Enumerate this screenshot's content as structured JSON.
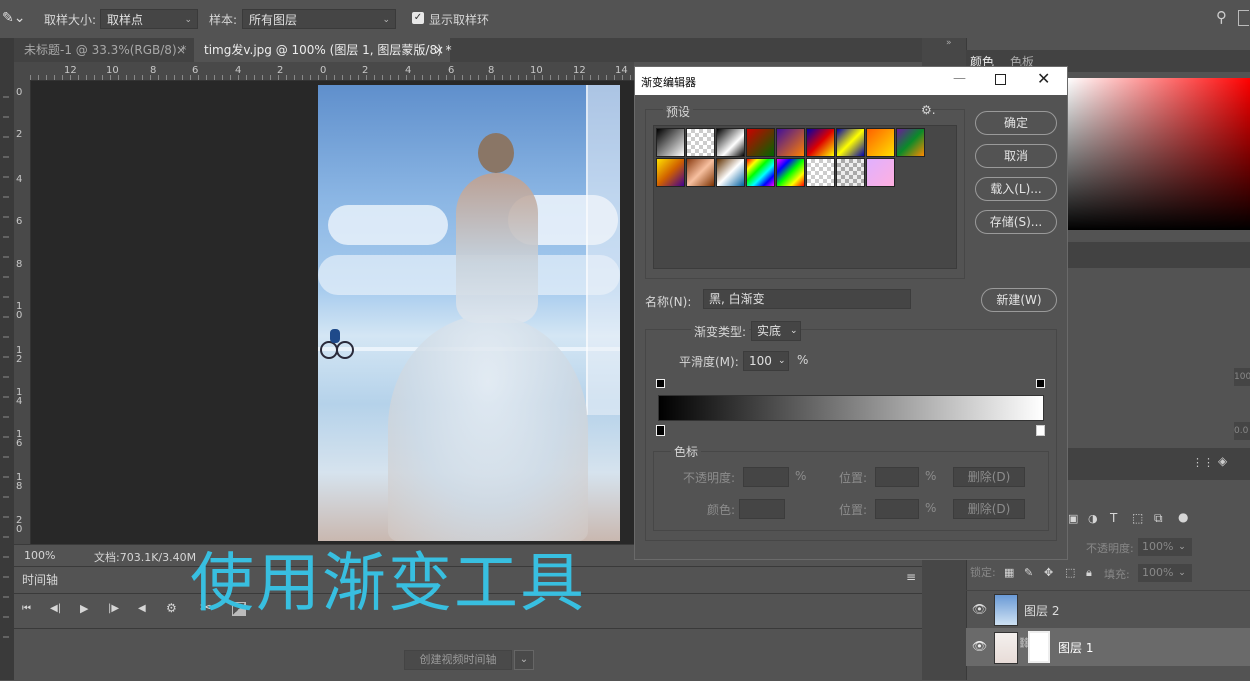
{
  "options_bar": {
    "sample_size_label": "取样大小:",
    "sample_size_value": "取样点",
    "sample_label": "样本:",
    "sample_value": "所有图层",
    "show_ring_label": "显示取样环"
  },
  "tabs": [
    {
      "label": "未标题-1 @ 33.3%(RGB/8) *"
    },
    {
      "label": "timg发v.jpg @ 100% (图层 1, 图层蒙版/8) *"
    }
  ],
  "ruler_h": [
    "12",
    "10",
    "8",
    "6",
    "4",
    "2",
    "0",
    "2",
    "4",
    "6",
    "8",
    "10",
    "12",
    "14"
  ],
  "ruler_v": [
    "0",
    "2",
    "4",
    "6",
    "8",
    "1\n0",
    "1\n2",
    "1\n4",
    "1\n6",
    "1\n8",
    "2\n0"
  ],
  "status": {
    "zoom": "100%",
    "doc": "文档:703.1K/3.40M"
  },
  "timeline": {
    "title": "时间轴",
    "create_button": "创建视频时间轴"
  },
  "caption": "使用渐变工具",
  "dialog": {
    "title": "渐变编辑器",
    "presets_label": "预设",
    "buttons": {
      "ok": "确定",
      "cancel": "取消",
      "load": "载入(L)...",
      "save": "存储(S)...",
      "new": "新建(W)"
    },
    "name_label": "名称(N):",
    "name_value": "黑, 白渐变",
    "gradient_type_label": "渐变类型:",
    "gradient_type_value": "实底",
    "smoothness_label": "平滑度(M):",
    "smoothness_value": "100",
    "smoothness_unit": "%",
    "stops_label": "色标",
    "opacity_label": "不透明度:",
    "opacity_unit": "%",
    "location_label": "位置:",
    "location_unit": "%",
    "delete_label": "删除(D)",
    "color_label": "颜色:"
  },
  "right_panel": {
    "tab_color": "颜色",
    "tab_swatches": "色板",
    "opacity_label": "不透明度:",
    "opacity_value": "100%",
    "lock_label": "锁定:",
    "fill_label": "填充:",
    "fill_value": "100%",
    "value_100": "100",
    "value_00": "0.0",
    "layers": [
      {
        "name": "图层 2"
      },
      {
        "name": "图层 1"
      }
    ]
  },
  "colors": {
    "caption": "#38bfe0",
    "dialog_bg": "#535353"
  }
}
